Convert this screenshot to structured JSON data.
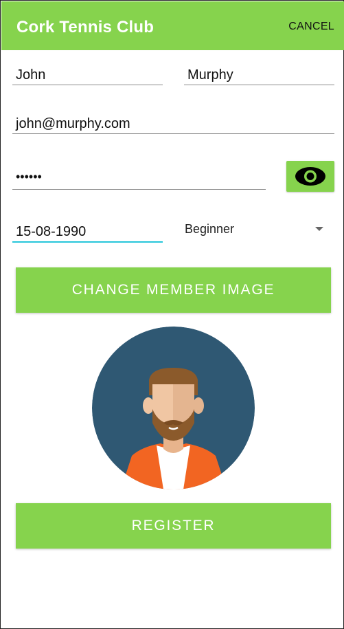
{
  "appbar": {
    "title": "Cork Tennis Club",
    "cancel_label": "CANCEL",
    "background": "#86d34d"
  },
  "form": {
    "first_name": "John",
    "last_name": "Murphy",
    "email": "john@murphy.com",
    "password_masked": "••••••",
    "date_of_birth": "15-08-1990",
    "level": "Beginner"
  },
  "icons": {
    "eye": "eye-icon",
    "dropdown": "caret-down-icon",
    "avatar": "member-avatar"
  },
  "buttons": {
    "change_image": "CHANGE MEMBER IMAGE",
    "register": "REGISTER"
  },
  "colors": {
    "accent": "#86d34d",
    "focus_underline": "#26c6da",
    "avatar_bg": "#2f5873",
    "shirt": "#f26522"
  }
}
